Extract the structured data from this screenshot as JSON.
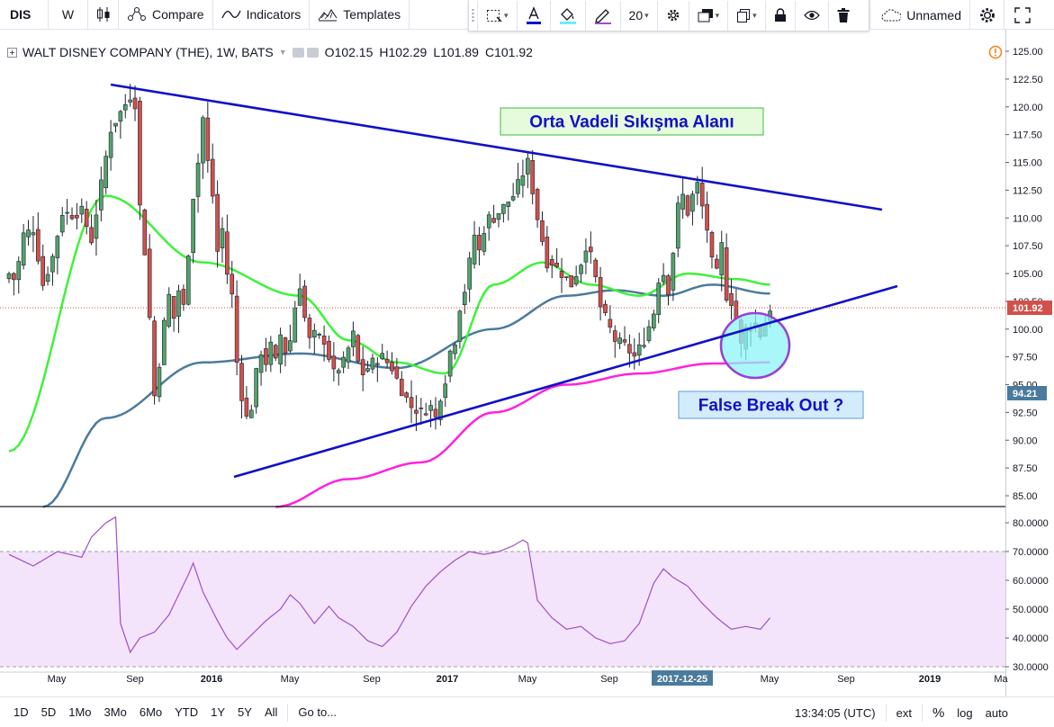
{
  "toolbar": {
    "symbol": "DIS",
    "interval": "W",
    "compare_label": "Compare",
    "indicators_label": "Indicators",
    "templates_label": "Templates",
    "line_width": "20",
    "layout_name": "Unnamed"
  },
  "legend": {
    "title": "WALT DISNEY COMPANY (THE), 1W, BATS",
    "o_key": "O",
    "o_val": "102.15",
    "h_key": "H",
    "h_val": "102.29",
    "l_key": "L",
    "l_val": "101.89",
    "c_key": "C",
    "c_val": "101.92"
  },
  "annotations": {
    "upper_text": "Orta Vadeli Sıkışma Alanı",
    "lower_text": "False Break Out ?"
  },
  "price_axis": {
    "ticks": [
      "125.00",
      "122.50",
      "120.00",
      "117.50",
      "115.00",
      "112.50",
      "110.00",
      "107.50",
      "105.00",
      "102.50",
      "100.00",
      "97.50",
      "95.00",
      "92.50",
      "90.00",
      "87.50",
      "85.00"
    ],
    "last_price_label": "101.92",
    "ma200_label": "94.21"
  },
  "rsi_axis": {
    "ticks": [
      "80.0000",
      "70.0000",
      "60.0000",
      "50.0000",
      "40.0000",
      "30.0000"
    ]
  },
  "time_axis": {
    "labels": [
      "May",
      "Sep",
      "2016",
      "May",
      "Sep",
      "2017",
      "May",
      "Sep",
      "2017-12-25",
      "May",
      "Sep",
      "2019",
      "Ma"
    ]
  },
  "bottom_bar": {
    "ranges": [
      "1D",
      "5D",
      "1Mo",
      "3Mo",
      "6Mo",
      "YTD",
      "1Y",
      "5Y",
      "All"
    ],
    "goto_label": "Go to...",
    "clock": "13:34:05 (UTC)",
    "ext_label": "ext",
    "pct_label": "%",
    "log_label": "log",
    "auto_label": "auto"
  },
  "colors": {
    "bull": "#53a36b",
    "bear": "#d2504b",
    "ma50": "#3ef23a",
    "ma100": "#4a7b9d",
    "ma200": "#ff21dd",
    "trend": "#1010c8",
    "rsi": "#a04fc7",
    "rsi_band": "#f3e4fb"
  },
  "chart_data": {
    "type": "candlestick",
    "price_range": [
      84,
      126
    ],
    "rsi_range": [
      28,
      83
    ],
    "rsi_bands": [
      30,
      70
    ],
    "price_anchors": [
      [
        0,
        105.0
      ],
      [
        1,
        104.5
      ],
      [
        2,
        106.0
      ],
      [
        3,
        108.5
      ],
      [
        5,
        109.0
      ],
      [
        7,
        104.0
      ],
      [
        9,
        106.5
      ],
      [
        11,
        110.5
      ],
      [
        13,
        110.3
      ],
      [
        15,
        110.6
      ],
      [
        17,
        108.0
      ],
      [
        19,
        113.0
      ],
      [
        21,
        118.0
      ],
      [
        23,
        119.5
      ],
      [
        25,
        121.0
      ],
      [
        26,
        120.3
      ],
      [
        27,
        111.0
      ],
      [
        28,
        107.0
      ],
      [
        29,
        101.0
      ],
      [
        30,
        94.0
      ],
      [
        31,
        97.0
      ],
      [
        32,
        100.5
      ],
      [
        33,
        103.0
      ],
      [
        34,
        101.0
      ],
      [
        35,
        103.5
      ],
      [
        36,
        102.0
      ],
      [
        37,
        107.0
      ],
      [
        38,
        112.0
      ],
      [
        39,
        115.0
      ],
      [
        40,
        119.0
      ],
      [
        41,
        115.0
      ],
      [
        42,
        112.0
      ],
      [
        43,
        107.0
      ],
      [
        44,
        109.0
      ],
      [
        45,
        105.0
      ],
      [
        46,
        103.0
      ],
      [
        47,
        97.0
      ],
      [
        48,
        94.0
      ],
      [
        49,
        92.0
      ],
      [
        50,
        93.0
      ],
      [
        51,
        96.0
      ],
      [
        52,
        98.0
      ],
      [
        53,
        97.0
      ],
      [
        54,
        98.5
      ],
      [
        55,
        97.0
      ],
      [
        56,
        99.5
      ],
      [
        57,
        98.0
      ],
      [
        58,
        99.0
      ],
      [
        59,
        102.0
      ],
      [
        60,
        104.0
      ],
      [
        61,
        101.0
      ],
      [
        62,
        99.0
      ],
      [
        63,
        99.5
      ],
      [
        65,
        99.0
      ],
      [
        67,
        96.0
      ],
      [
        69,
        97.0
      ],
      [
        71,
        99.5
      ],
      [
        72,
        97.0
      ],
      [
        73,
        96.0
      ],
      [
        75,
        97.0
      ],
      [
        77,
        97.5
      ],
      [
        79,
        96.5
      ],
      [
        81,
        94.5
      ],
      [
        83,
        93.0
      ],
      [
        85,
        92.5
      ],
      [
        87,
        93.0
      ],
      [
        88,
        92.0
      ],
      [
        89,
        94.0
      ],
      [
        90,
        95.5
      ],
      [
        91,
        98.0
      ],
      [
        92,
        99.0
      ],
      [
        93,
        102.0
      ],
      [
        94,
        103.5
      ],
      [
        95,
        106.0
      ],
      [
        96,
        108.5
      ],
      [
        97,
        107.0
      ],
      [
        98,
        109.0
      ],
      [
        99,
        110.0
      ],
      [
        100,
        110.0
      ],
      [
        102,
        111.0
      ],
      [
        104,
        112.0
      ],
      [
        106,
        114.0
      ],
      [
        107,
        115.0
      ],
      [
        108,
        112.5
      ],
      [
        109,
        110.0
      ],
      [
        110,
        108.0
      ],
      [
        111,
        106.0
      ],
      [
        112,
        106.0
      ],
      [
        114,
        105.0
      ],
      [
        116,
        104.0
      ],
      [
        118,
        106.0
      ],
      [
        119,
        107.5
      ],
      [
        120,
        106.5
      ],
      [
        121,
        104.5
      ],
      [
        122,
        102.0
      ],
      [
        123,
        101.0
      ],
      [
        124,
        100.0
      ],
      [
        125,
        99.0
      ],
      [
        127,
        98.5
      ],
      [
        129,
        97.5
      ],
      [
        131,
        99.0
      ],
      [
        133,
        101.5
      ],
      [
        134,
        104.5
      ],
      [
        135,
        105.0
      ],
      [
        136,
        103.5
      ],
      [
        137,
        107.0
      ],
      [
        138,
        111.0
      ],
      [
        139,
        112.0
      ],
      [
        140,
        110.5
      ],
      [
        141,
        112.0
      ],
      [
        142,
        113.0
      ],
      [
        143,
        111.0
      ],
      [
        144,
        109.0
      ],
      [
        145,
        106.0
      ],
      [
        146,
        105.0
      ],
      [
        147,
        107.5
      ],
      [
        148,
        103.0
      ],
      [
        149,
        102.5
      ],
      [
        150,
        101.0
      ],
      [
        151,
        98.5
      ],
      [
        152,
        100.0
      ],
      [
        154,
        100.5
      ],
      [
        155,
        99.5
      ],
      [
        156,
        100.5
      ],
      [
        157,
        101.9
      ]
    ],
    "ma50": [
      [
        0,
        89
      ],
      [
        20,
        112
      ],
      [
        40,
        106
      ],
      [
        60,
        103
      ],
      [
        70,
        99
      ],
      [
        80,
        97
      ],
      [
        90,
        96
      ],
      [
        100,
        104
      ],
      [
        110,
        106
      ],
      [
        120,
        104
      ],
      [
        130,
        103
      ],
      [
        140,
        105
      ],
      [
        150,
        104.5
      ],
      [
        157,
        104
      ]
    ],
    "ma100": [
      [
        7,
        84
      ],
      [
        20,
        92
      ],
      [
        40,
        97
      ],
      [
        60,
        97.8
      ],
      [
        80,
        96.5
      ],
      [
        100,
        100
      ],
      [
        115,
        103
      ],
      [
        125,
        103.5
      ],
      [
        135,
        103
      ],
      [
        145,
        104
      ],
      [
        157,
        103.2
      ]
    ],
    "ma200": [
      [
        55,
        84
      ],
      [
        70,
        86.5
      ],
      [
        85,
        88
      ],
      [
        100,
        92.5
      ],
      [
        115,
        95
      ],
      [
        130,
        96
      ],
      [
        145,
        96.9
      ],
      [
        157,
        97
      ]
    ],
    "trendlines": [
      {
        "name": "upper",
        "from": [
          123,
          94
        ],
        "to": [
          980,
          233
        ]
      },
      {
        "name": "lower",
        "from": [
          260,
          530
        ],
        "to": [
          997,
          318
        ]
      }
    ],
    "rsi": [
      [
        0,
        69
      ],
      [
        5,
        65
      ],
      [
        10,
        70
      ],
      [
        15,
        68
      ],
      [
        17,
        75
      ],
      [
        20,
        80
      ],
      [
        22,
        82
      ],
      [
        23,
        45
      ],
      [
        25,
        35
      ],
      [
        27,
        40
      ],
      [
        30,
        42
      ],
      [
        33,
        48
      ],
      [
        35,
        55
      ],
      [
        37,
        62
      ],
      [
        38,
        66
      ],
      [
        40,
        56
      ],
      [
        43,
        46
      ],
      [
        45,
        40
      ],
      [
        47,
        36
      ],
      [
        50,
        41
      ],
      [
        53,
        46
      ],
      [
        56,
        50
      ],
      [
        58,
        55
      ],
      [
        60,
        52
      ],
      [
        63,
        45
      ],
      [
        66,
        51
      ],
      [
        68,
        47
      ],
      [
        71,
        44
      ],
      [
        74,
        39
      ],
      [
        77,
        37
      ],
      [
        80,
        42
      ],
      [
        83,
        51
      ],
      [
        86,
        58
      ],
      [
        89,
        63
      ],
      [
        92,
        67
      ],
      [
        95,
        70
      ],
      [
        98,
        69
      ],
      [
        101,
        70
      ],
      [
        104,
        72
      ],
      [
        106,
        74
      ],
      [
        107,
        73
      ],
      [
        109,
        53
      ],
      [
        112,
        47
      ],
      [
        115,
        43
      ],
      [
        118,
        44
      ],
      [
        121,
        40
      ],
      [
        124,
        38
      ],
      [
        127,
        39
      ],
      [
        130,
        45
      ],
      [
        133,
        59
      ],
      [
        135,
        64
      ],
      [
        137,
        61
      ],
      [
        140,
        58
      ],
      [
        143,
        52
      ],
      [
        146,
        47
      ],
      [
        149,
        43
      ],
      [
        152,
        44
      ],
      [
        155,
        43
      ],
      [
        157,
        47
      ]
    ]
  }
}
